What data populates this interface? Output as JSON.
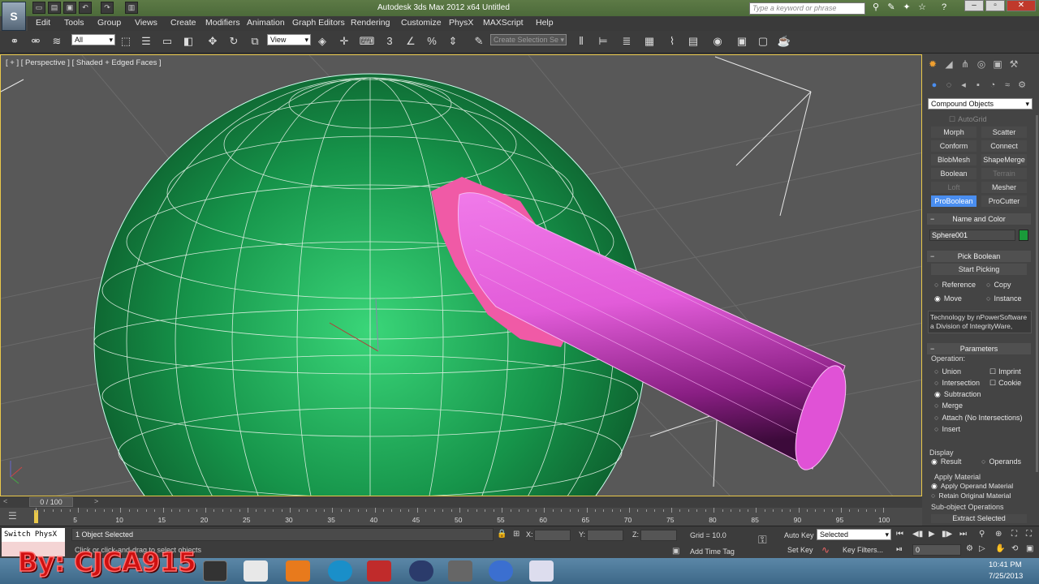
{
  "app": {
    "title": "Autodesk 3ds Max  2012 x64      Untitled",
    "logo": "S"
  },
  "search": {
    "placeholder": "Type a keyword or phrase"
  },
  "menu": [
    "Edit",
    "Tools",
    "Group",
    "Views",
    "Create",
    "Modifiers",
    "Animation",
    "Graph Editors",
    "Rendering",
    "Customize",
    "PhysX",
    "MAXScript",
    "Help"
  ],
  "toolbar": {
    "selection_filter": "All",
    "ref_coord": "View",
    "named_selection": "Create Selection Se",
    "snap_toggle": "3"
  },
  "viewport": {
    "label": "[ + ] [ Perspective ] [ Shaded + Edged Faces ]"
  },
  "panel": {
    "category": "Compound Objects",
    "autogrid": "AutoGrid",
    "buttons": [
      "Morph",
      "Scatter",
      "Conform",
      "Connect",
      "BlobMesh",
      "ShapeMerge",
      "Boolean",
      "Terrain",
      "Loft",
      "Mesher",
      "ProBoolean",
      "ProCutter"
    ],
    "name_color_header": "Name and Color",
    "object_name": "Sphere001",
    "object_color": "#1a9a3a",
    "pick_header": "Pick Boolean",
    "start_picking": "Start Picking",
    "pick_opts": [
      "Reference",
      "Copy",
      "Move",
      "Instance"
    ],
    "tech_text": "Technology by nPowerSoftware a Division of IntegrityWare,",
    "params_header": "Parameters",
    "operation_label": "Operation:",
    "operations": [
      "Union",
      "Intersection",
      "Subtraction",
      "Merge",
      "Attach (No Intersections)",
      "Insert"
    ],
    "op_checks": [
      "Imprint",
      "Cookie"
    ],
    "display_label": "Display",
    "display_opts": [
      "Result",
      "Operands"
    ],
    "apply_material_label": "Apply Material",
    "material_opts": [
      "Apply Operand Material",
      "Retain Original Material"
    ],
    "subobj_label": "Sub-object Operations",
    "extract_label": "Extract Selected"
  },
  "timeline": {
    "frame": "0 / 100",
    "ticks": [
      "0",
      "5",
      "10",
      "15",
      "20",
      "25",
      "30",
      "35",
      "40",
      "45",
      "50",
      "55",
      "60",
      "65",
      "70",
      "75",
      "80",
      "85",
      "90",
      "95",
      "100"
    ]
  },
  "status": {
    "physx": "Switch PhysX",
    "selected_text": "1 Object Selected",
    "prompt": "Click or click-and-drag to select objects",
    "x_label": "X:",
    "y_label": "Y:",
    "z_label": "Z:",
    "grid": "Grid = 10.0",
    "add_time_tag": "Add Time Tag",
    "auto_key": "Auto Key",
    "set_key": "Set Key",
    "key_mode": "Selected",
    "key_filters": "Key Filters...",
    "frame_field": "0"
  },
  "watermark": "By: CJCA915",
  "clock": {
    "time": "10:41 PM",
    "date": "7/25/2013"
  }
}
